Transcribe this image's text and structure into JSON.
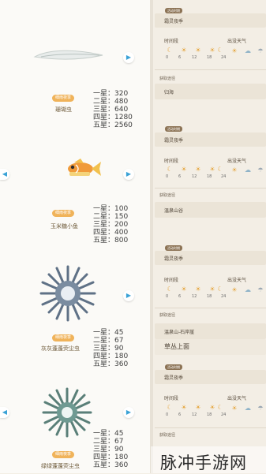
{
  "creatures": [
    {
      "name": "珊瑚虫",
      "badge": "细雨夜季",
      "stars": [
        "一星：320",
        "二星：480",
        "三星：640",
        "四星：1280",
        "五星：2560"
      ]
    },
    {
      "name": "玉米糖小鱼",
      "badge": "细雨夜季",
      "stars": [
        "一星：100",
        "二星：150",
        "三星：200",
        "四星：400",
        "五星：800"
      ]
    },
    {
      "name": "灰灰蓬蓬荧尘虫",
      "badge": "细雨夜季",
      "stars": [
        "一星：45",
        "二星：67",
        "三星：90",
        "四星：180",
        "五星：360"
      ]
    },
    {
      "name": "绿绿蓬蓬荧尘虫",
      "badge": "细雨夜季",
      "stars": [
        "一星：45",
        "二星：67",
        "三星：90",
        "四星：180",
        "五星：360"
      ]
    }
  ],
  "nav": {
    "next": "▶",
    "prev": "◀"
  },
  "details": {
    "season_tag": "活动时期",
    "season": "霜灵夜季",
    "time_label": "时间段",
    "weather_label": "出没天气",
    "time_ticks": [
      "0",
      "6",
      "12",
      "18",
      "24"
    ],
    "getway_label": "获取途径",
    "locations": [
      "归海",
      "温泉山谷",
      "温泉山-石岸崖",
      "草丛上面"
    ]
  },
  "watermark": "脉冲手游网"
}
